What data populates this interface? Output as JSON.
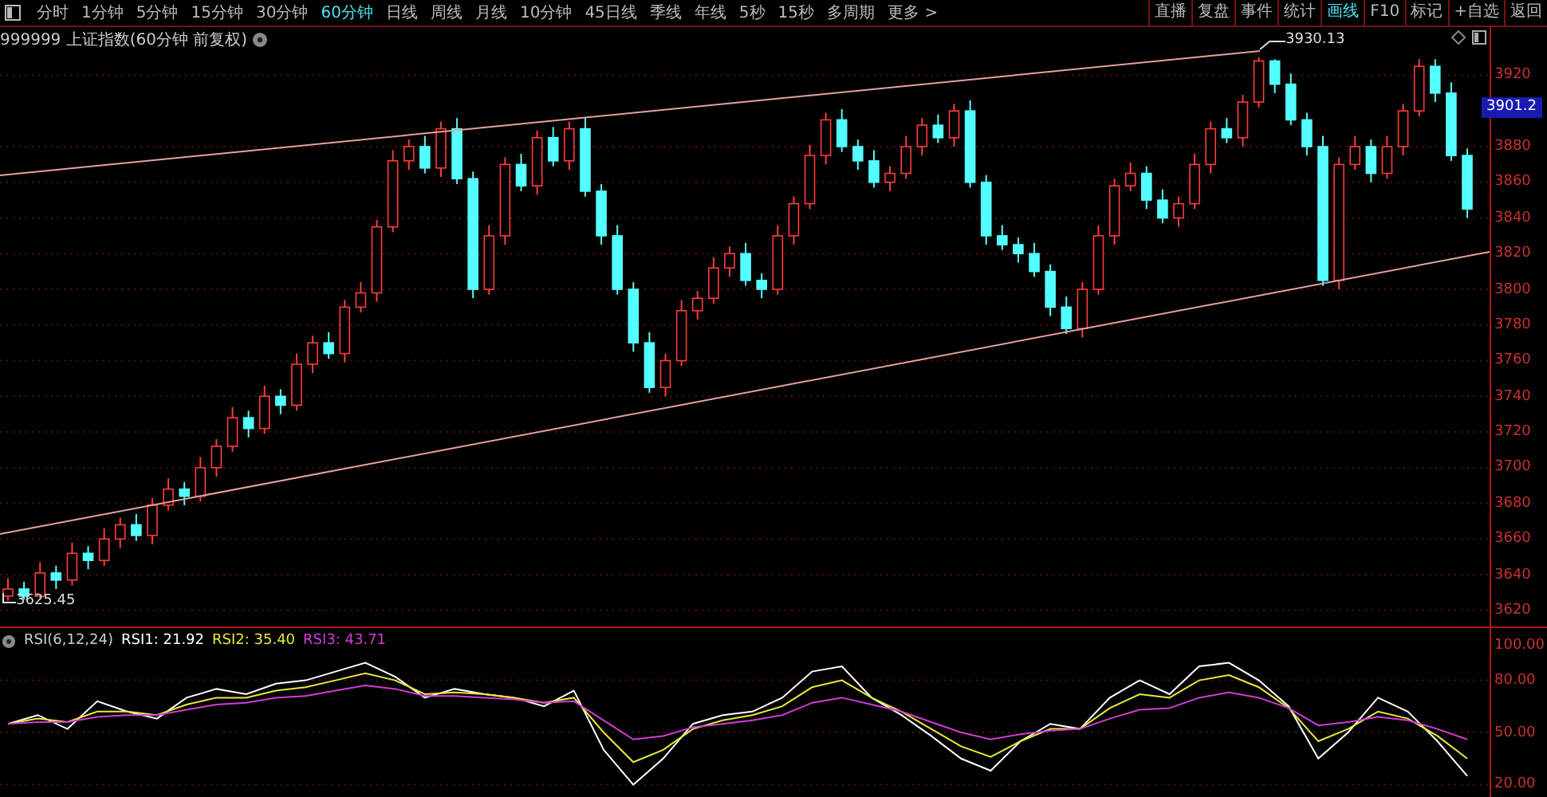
{
  "toolbar": {
    "periods": [
      {
        "label": "分时",
        "selected": false
      },
      {
        "label": "1分钟",
        "selected": false
      },
      {
        "label": "5分钟",
        "selected": false
      },
      {
        "label": "15分钟",
        "selected": false
      },
      {
        "label": "30分钟",
        "selected": false
      },
      {
        "label": "60分钟",
        "selected": true
      },
      {
        "label": "日线",
        "selected": false
      },
      {
        "label": "周线",
        "selected": false
      },
      {
        "label": "月线",
        "selected": false
      },
      {
        "label": "10分钟",
        "selected": false
      },
      {
        "label": "45日线",
        "selected": false
      },
      {
        "label": "季线",
        "selected": false
      },
      {
        "label": "年线",
        "selected": false
      },
      {
        "label": "5秒",
        "selected": false
      },
      {
        "label": "15秒",
        "selected": false
      },
      {
        "label": "多周期",
        "selected": false
      },
      {
        "label": "更多 >",
        "selected": false
      }
    ],
    "actions": [
      {
        "label": "直播",
        "selected": false
      },
      {
        "label": "复盘",
        "selected": false
      },
      {
        "label": "事件",
        "selected": false
      },
      {
        "label": "统计",
        "selected": false
      },
      {
        "label": "画线",
        "selected": true
      },
      {
        "label": "F10",
        "selected": false
      },
      {
        "label": "标记",
        "selected": false
      },
      {
        "label": "+自选",
        "selected": false
      },
      {
        "label": "返回",
        "selected": false
      }
    ]
  },
  "title": "999999 上证指数(60分钟 前复权)",
  "price_chart": {
    "last_price": "3901.2",
    "high_marker": "3930.13",
    "low_marker": "3625.45",
    "chart_data": {
      "type": "candlestick",
      "ylim": [
        3611,
        3947
      ],
      "grid": true,
      "yticks": [
        {
          "value": 3920,
          "label": "3920"
        },
        {
          "value": 3880,
          "label": "3880"
        },
        {
          "value": 3860,
          "label": "3860"
        },
        {
          "value": 3840,
          "label": "3840"
        },
        {
          "value": 3820,
          "label": "3820"
        },
        {
          "value": 3800,
          "label": "3800"
        },
        {
          "value": 3780,
          "label": "3780"
        },
        {
          "value": 3760,
          "label": "3760"
        },
        {
          "value": 3740,
          "label": "3740"
        },
        {
          "value": 3720,
          "label": "3720"
        },
        {
          "value": 3700,
          "label": "3700"
        },
        {
          "value": 3680,
          "label": "3680"
        },
        {
          "value": 3660,
          "label": "3660"
        },
        {
          "value": 3640,
          "label": "3640"
        },
        {
          "value": 3620,
          "label": "3620"
        }
      ],
      "ohlc": [
        [
          3628,
          3638,
          3625.45,
          3632
        ],
        [
          3632,
          3636,
          3626,
          3628
        ],
        [
          3628,
          3647,
          3627,
          3641
        ],
        [
          3641,
          3645,
          3632,
          3637
        ],
        [
          3637,
          3658,
          3634,
          3652
        ],
        [
          3652,
          3656,
          3643,
          3648
        ],
        [
          3648,
          3666,
          3645,
          3660
        ],
        [
          3660,
          3672,
          3655,
          3668
        ],
        [
          3668,
          3674,
          3659,
          3662
        ],
        [
          3662,
          3683,
          3657,
          3679
        ],
        [
          3679,
          3694,
          3676,
          3688
        ],
        [
          3688,
          3692,
          3679,
          3684
        ],
        [
          3684,
          3706,
          3681,
          3700
        ],
        [
          3700,
          3716,
          3695,
          3712
        ],
        [
          3712,
          3734,
          3709,
          3728
        ],
        [
          3728,
          3732,
          3717,
          3722
        ],
        [
          3722,
          3746,
          3719,
          3740
        ],
        [
          3740,
          3744,
          3730,
          3735
        ],
        [
          3735,
          3764,
          3732,
          3758
        ],
        [
          3758,
          3774,
          3753,
          3770
        ],
        [
          3770,
          3776,
          3761,
          3764
        ],
        [
          3764,
          3794,
          3759,
          3790
        ],
        [
          3790,
          3804,
          3787,
          3798
        ],
        [
          3798,
          3839,
          3793,
          3835
        ],
        [
          3835,
          3878,
          3832,
          3872
        ],
        [
          3872,
          3884,
          3867,
          3880
        ],
        [
          3880,
          3886,
          3865,
          3868
        ],
        [
          3868,
          3894,
          3863,
          3890
        ],
        [
          3890,
          3896,
          3859,
          3862
        ],
        [
          3862,
          3866,
          3795,
          3800
        ],
        [
          3800,
          3836,
          3797,
          3830
        ],
        [
          3830,
          3874,
          3825,
          3870
        ],
        [
          3870,
          3876,
          3855,
          3858
        ],
        [
          3858,
          3889,
          3853,
          3885
        ],
        [
          3885,
          3891,
          3869,
          3872
        ],
        [
          3872,
          3894,
          3867,
          3890
        ],
        [
          3890,
          3896,
          3852,
          3855
        ],
        [
          3855,
          3859,
          3825,
          3830
        ],
        [
          3830,
          3836,
          3797,
          3800
        ],
        [
          3800,
          3804,
          3765,
          3770
        ],
        [
          3770,
          3776,
          3742,
          3745
        ],
        [
          3745,
          3764,
          3740,
          3760
        ],
        [
          3760,
          3794,
          3757,
          3788
        ],
        [
          3788,
          3799,
          3783,
          3795
        ],
        [
          3795,
          3818,
          3792,
          3812
        ],
        [
          3812,
          3824,
          3807,
          3820
        ],
        [
          3820,
          3826,
          3802,
          3805
        ],
        [
          3805,
          3809,
          3795,
          3800
        ],
        [
          3800,
          3836,
          3797,
          3830
        ],
        [
          3830,
          3852,
          3825,
          3848
        ],
        [
          3848,
          3881,
          3845,
          3875
        ],
        [
          3875,
          3899,
          3870,
          3895
        ],
        [
          3895,
          3901,
          3877,
          3880
        ],
        [
          3880,
          3884,
          3867,
          3872
        ],
        [
          3872,
          3878,
          3857,
          3860
        ],
        [
          3860,
          3869,
          3855,
          3865
        ],
        [
          3865,
          3886,
          3862,
          3880
        ],
        [
          3880,
          3896,
          3875,
          3892
        ],
        [
          3892,
          3898,
          3882,
          3885
        ],
        [
          3885,
          3904,
          3880,
          3900
        ],
        [
          3900,
          3906,
          3857,
          3860
        ],
        [
          3860,
          3864,
          3825,
          3830
        ],
        [
          3830,
          3836,
          3822,
          3825
        ],
        [
          3825,
          3829,
          3815,
          3820
        ],
        [
          3820,
          3826,
          3807,
          3810
        ],
        [
          3810,
          3814,
          3785,
          3790
        ],
        [
          3790,
          3796,
          3775,
          3778
        ],
        [
          3778,
          3804,
          3773,
          3800
        ],
        [
          3800,
          3836,
          3797,
          3830
        ],
        [
          3830,
          3862,
          3825,
          3858
        ],
        [
          3858,
          3871,
          3855,
          3865
        ],
        [
          3865,
          3869,
          3845,
          3850
        ],
        [
          3850,
          3856,
          3837,
          3840
        ],
        [
          3840,
          3852,
          3835,
          3848
        ],
        [
          3848,
          3876,
          3845,
          3870
        ],
        [
          3870,
          3894,
          3865,
          3890
        ],
        [
          3890,
          3896,
          3882,
          3885
        ],
        [
          3885,
          3909,
          3880,
          3905
        ],
        [
          3905,
          3930.13,
          3902,
          3928
        ],
        [
          3928,
          3929,
          3910,
          3915
        ],
        [
          3915,
          3921,
          3892,
          3895
        ],
        [
          3895,
          3899,
          3875,
          3880
        ],
        [
          3880,
          3886,
          3802,
          3805
        ],
        [
          3805,
          3874,
          3800,
          3870
        ],
        [
          3870,
          3886,
          3867,
          3880
        ],
        [
          3880,
          3884,
          3860,
          3865
        ],
        [
          3865,
          3886,
          3862,
          3880
        ],
        [
          3880,
          3904,
          3875,
          3900
        ],
        [
          3900,
          3929,
          3897,
          3925
        ],
        [
          3925,
          3929,
          3905,
          3910
        ],
        [
          3910,
          3916,
          3872,
          3875
        ],
        [
          3875,
          3879,
          3840,
          3845
        ]
      ]
    }
  },
  "rsi_panel": {
    "title": "RSI(6,12,24)",
    "chart_data": {
      "type": "line",
      "ylim": [
        12,
        110
      ],
      "grid": true,
      "yticks": [
        {
          "value": 100,
          "label": "100.00"
        },
        {
          "value": 80,
          "label": "80.00"
        },
        {
          "value": 50,
          "label": "50.00"
        },
        {
          "value": 20,
          "label": "20.00"
        }
      ],
      "series": [
        {
          "name": "RSI1: 21.92",
          "color": "#ffffff",
          "values": [
            55,
            60,
            52,
            68,
            62,
            58,
            70,
            75,
            72,
            78,
            80,
            85,
            90,
            82,
            70,
            75,
            72,
            70,
            65,
            74,
            40,
            20,
            35,
            55,
            60,
            62,
            70,
            85,
            88,
            70,
            60,
            48,
            35,
            28,
            45,
            55,
            52,
            70,
            80,
            72,
            88,
            90,
            80,
            65,
            35,
            50,
            70,
            62,
            45,
            25
          ]
        },
        {
          "name": "RSI2: 35.40",
          "color": "#e8e83c",
          "values": [
            55,
            58,
            56,
            62,
            62,
            60,
            66,
            70,
            70,
            74,
            76,
            80,
            84,
            80,
            72,
            73,
            72,
            70,
            67,
            70,
            50,
            33,
            40,
            52,
            57,
            60,
            65,
            76,
            80,
            70,
            62,
            52,
            42,
            36,
            45,
            52,
            52,
            64,
            72,
            70,
            80,
            83,
            76,
            64,
            45,
            52,
            62,
            58,
            48,
            35
          ]
        },
        {
          "name": "RSI3: 43.71",
          "color": "#d23cd2",
          "values": [
            55,
            56,
            56,
            59,
            60,
            60,
            63,
            66,
            67,
            70,
            71,
            74,
            77,
            75,
            71,
            71,
            70,
            69,
            67,
            68,
            57,
            46,
            48,
            53,
            55,
            57,
            60,
            67,
            70,
            66,
            62,
            56,
            50,
            46,
            49,
            51,
            52,
            58,
            63,
            64,
            70,
            73,
            70,
            64,
            54,
            56,
            59,
            57,
            52,
            46
          ]
        }
      ]
    }
  }
}
